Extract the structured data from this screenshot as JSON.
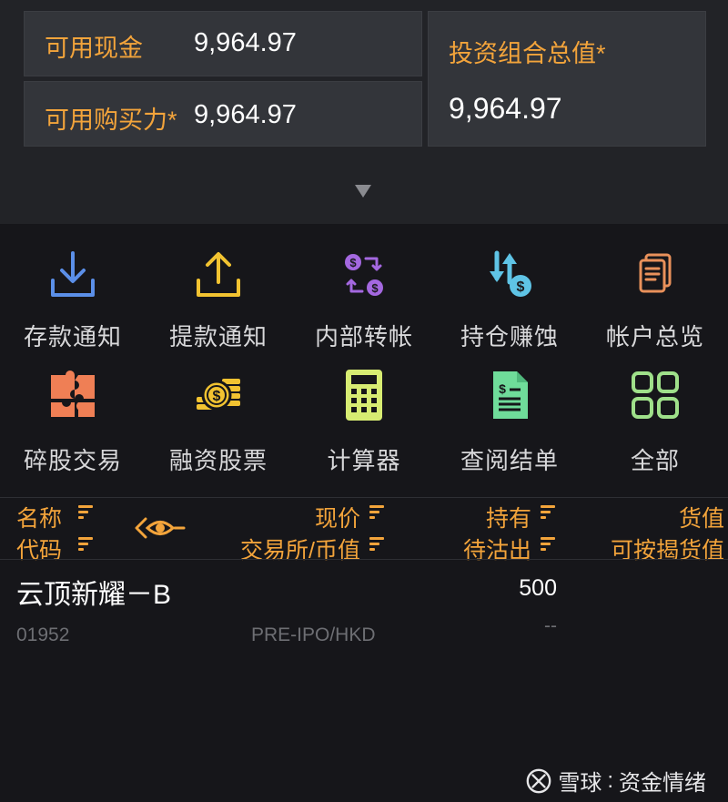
{
  "summary": {
    "cash_label": "可用现金",
    "cash_value": "9,964.97",
    "buying_power_label": "可用购买力*",
    "buying_power_value": "9,964.97",
    "portfolio_label": "投资组合总值*",
    "portfolio_value": "9,964.97"
  },
  "grid": [
    {
      "label": "存款通知",
      "icon": "deposit-download-icon",
      "color": "#5b8fe8"
    },
    {
      "label": "提款通知",
      "icon": "withdraw-upload-icon",
      "color": "#f2c331"
    },
    {
      "label": "内部转帐",
      "icon": "internal-transfer-icon",
      "color": "#a468e0"
    },
    {
      "label": "持仓赚蚀",
      "icon": "position-pnl-icon",
      "color": "#5fc4e6"
    },
    {
      "label": "帐户总览",
      "icon": "account-overview-icon",
      "color": "#e9915b"
    },
    {
      "label": "碎股交易",
      "icon": "puzzle-icon",
      "color": "#ef7f55"
    },
    {
      "label": "融资股票",
      "icon": "margin-coins-icon",
      "color": "#f2c331"
    },
    {
      "label": "计算器",
      "icon": "calculator-icon",
      "color": "#d7ec72"
    },
    {
      "label": "查阅结单",
      "icon": "statement-icon",
      "color": "#6fdc9a"
    },
    {
      "label": "全部",
      "icon": "all-apps-icon",
      "color": "#9fe08a"
    }
  ],
  "table_header": {
    "name": "名称",
    "code": "代码",
    "price": "现价",
    "exchange_currency": "交易所/币值",
    "holding": "持有",
    "pending_sell": "待沽出",
    "value": "货值",
    "mortgage_value": "可按揭货值"
  },
  "rows": [
    {
      "name": "云顶新耀－B",
      "code": "01952",
      "exchange": "PRE-IPO/HKD",
      "holding": "500",
      "pending": "--"
    }
  ],
  "watermark": {
    "brand": "雪球",
    "author": "资金情绪"
  }
}
